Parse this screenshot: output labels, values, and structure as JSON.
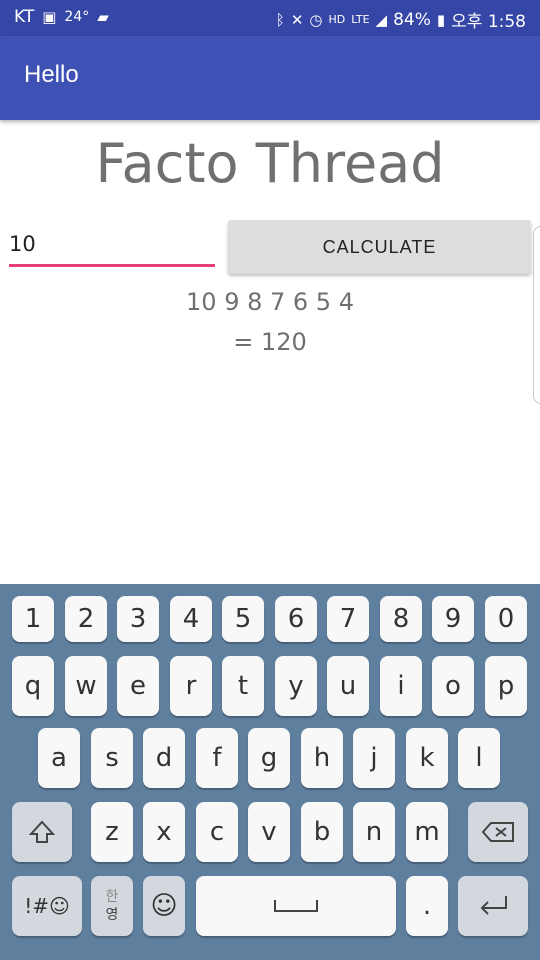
{
  "status_bar": {
    "carrier": "KT",
    "temperature": "24°",
    "battery": "84%",
    "time": "오후 1:58"
  },
  "app_bar": {
    "title": "Hello"
  },
  "main": {
    "heading": "Facto Thread",
    "input_value": "10",
    "button_label": "CALCULATE",
    "sequence": "10 9 8 7 6 5 4",
    "result": "= 120"
  },
  "keyboard": {
    "row1": [
      "1",
      "2",
      "3",
      "4",
      "5",
      "6",
      "7",
      "8",
      "9",
      "0"
    ],
    "row2": [
      "q",
      "w",
      "e",
      "r",
      "t",
      "y",
      "u",
      "i",
      "o",
      "p"
    ],
    "row3": [
      "a",
      "s",
      "d",
      "f",
      "g",
      "h",
      "j",
      "k",
      "l"
    ],
    "row4": [
      "z",
      "x",
      "c",
      "v",
      "b",
      "n",
      "m"
    ],
    "symbols_label": "!#☺",
    "lang_top": "한",
    "lang_bottom": "영",
    "period": "."
  }
}
